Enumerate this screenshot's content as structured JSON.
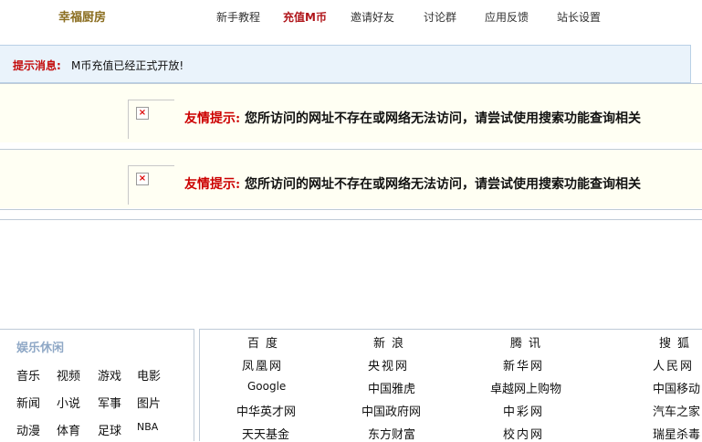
{
  "header": {
    "logo": "幸福厨房",
    "nav": [
      "新手教程",
      "充值M币",
      "邀请好友",
      "讨论群",
      "应用反馈",
      "站长设置"
    ]
  },
  "notice": {
    "label": "提示消息:",
    "message": "M币充值已经正式开放!"
  },
  "error_blocks": [
    {
      "title": "友情提示:",
      "message": "您所访问的网址不存在或网络无法访问，请尝试使用搜索功能查询相关"
    },
    {
      "title": "友情提示:",
      "message": "您所访问的网址不存在或网络无法访问，请尝试使用搜索功能查询相关"
    }
  ],
  "entertainment": {
    "title": "娱乐休闲",
    "items": [
      "音乐",
      "视频",
      "游戏",
      "电影",
      "新闻",
      "小说",
      "军事",
      "图片",
      "动漫",
      "体育",
      "足球",
      "NBA"
    ]
  },
  "sites": [
    [
      "百度",
      "新浪",
      "腾讯",
      "搜狐"
    ],
    [
      "凤凰网",
      "央视网",
      "新华网",
      "人民网"
    ],
    [
      "Google",
      "中国雅虎",
      "卓越网上购物",
      "中国移动"
    ],
    [
      "中华英才网",
      "中国政府网",
      "中彩网",
      "汽车之家"
    ],
    [
      "天天基金",
      "东方财富",
      "校内网",
      "瑞星杀毒"
    ]
  ]
}
